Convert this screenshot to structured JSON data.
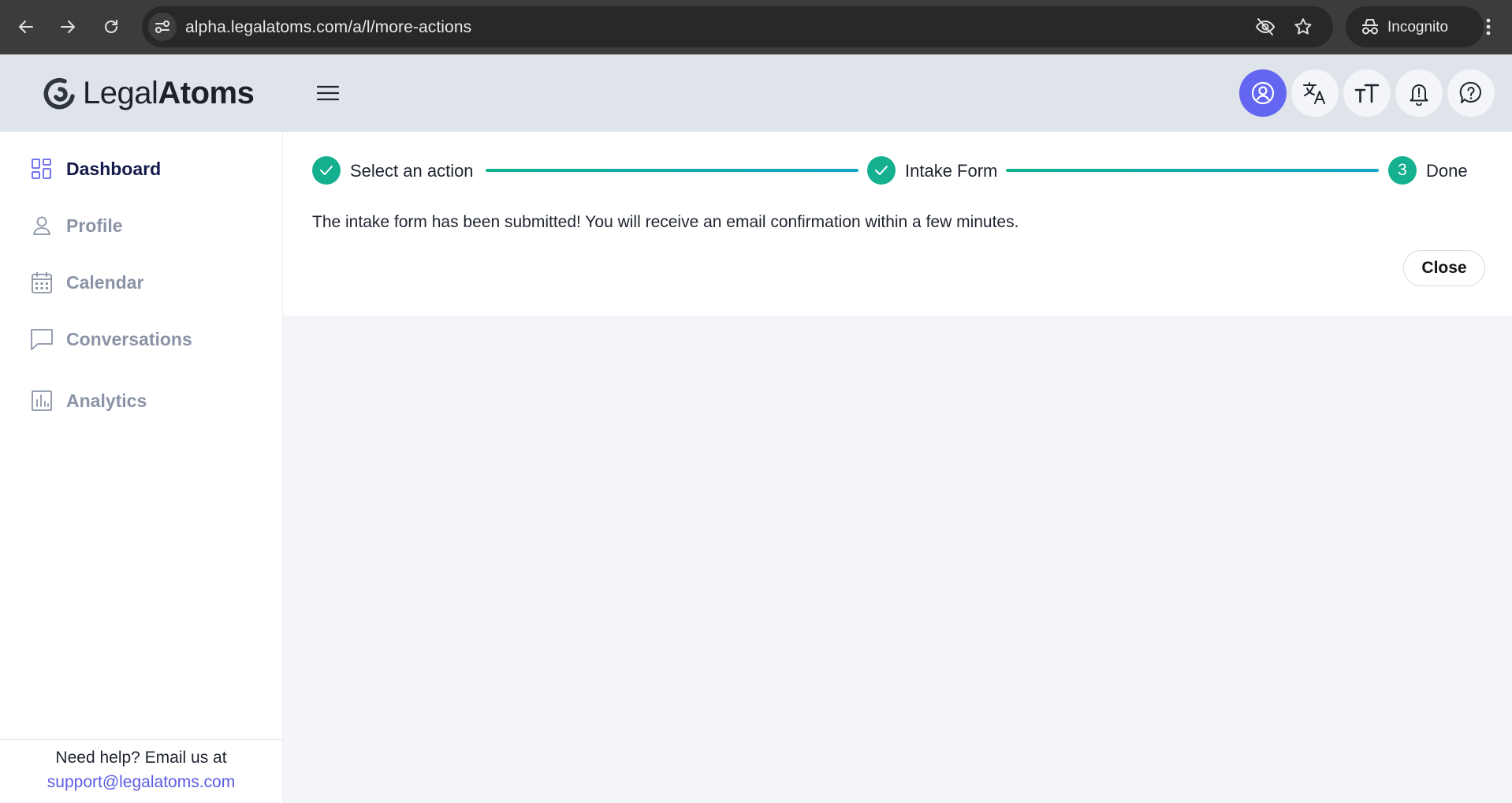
{
  "browser": {
    "url": "alpha.legalatoms.com/a/l/more-actions",
    "incognito_label": "Incognito",
    "icons": [
      "back-arrow-icon",
      "forward-arrow-icon",
      "reload-icon",
      "site-info-icon",
      "eye-slash-icon",
      "star-icon",
      "incognito-icon",
      "more-vert-icon"
    ]
  },
  "brand": {
    "prefix": "Legal",
    "suffix": "Atoms"
  },
  "header": {
    "icons": [
      "hamburger-icon",
      "user-circle-icon",
      "translate-icon",
      "font-size-icon",
      "bell-icon",
      "help-circle-icon"
    ]
  },
  "sidebar": {
    "items": [
      {
        "label": "Dashboard",
        "icon": "dashboard-grid-icon",
        "active": true
      },
      {
        "label": "Profile",
        "icon": "person-icon",
        "active": false
      },
      {
        "label": "Calendar",
        "icon": "calendar-icon",
        "active": false
      },
      {
        "label": "Conversations",
        "icon": "chat-bubble-icon",
        "active": false
      },
      {
        "label": "Analytics",
        "icon": "bar-chart-icon",
        "active": false
      }
    ],
    "help": {
      "text": "Need help? Email us at",
      "email": "support@legalatoms.com"
    }
  },
  "stepper": {
    "steps": [
      {
        "label": "Select an action",
        "state": "complete"
      },
      {
        "label": "Intake Form",
        "state": "complete"
      },
      {
        "label": "Done",
        "state": "current",
        "number": "3"
      }
    ]
  },
  "main": {
    "message": "The intake form has been submitted! You will receive an email confirmation within a few minutes.",
    "close_label": "Close"
  },
  "colors": {
    "accent": "#6366f1",
    "success": "#14b08f",
    "link": "#5b5be6",
    "header_bg": "#dfe3ea"
  }
}
